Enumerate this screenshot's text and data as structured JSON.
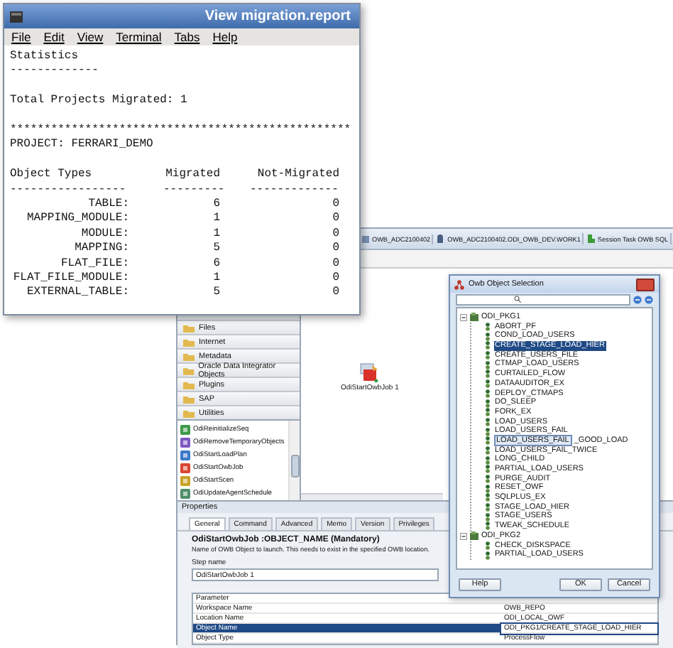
{
  "terminal": {
    "title": "View migration.report",
    "menu": [
      "File",
      "Edit",
      "View",
      "Terminal",
      "Tabs",
      "Help"
    ],
    "paragraphs": [
      [
        "Statistics",
        "-------------"
      ],
      [
        "Total Projects Migrated: 1"
      ],
      [
        "**************************************************",
        "PROJECT: FERRARI_DEMO"
      ]
    ],
    "table": {
      "columns": [
        "Object Types",
        "Migrated",
        "Not-Migrated"
      ],
      "rules": [
        "-----------------",
        "---------",
        "-------------"
      ],
      "rows": [
        {
          "type": "TABLE:",
          "migrated": "6",
          "not_migrated": "0"
        },
        {
          "type": "MAPPING_MODULE:",
          "migrated": "1",
          "not_migrated": "0"
        },
        {
          "type": "MODULE:",
          "migrated": "1",
          "not_migrated": "0"
        },
        {
          "type": "MAPPING:",
          "migrated": "5",
          "not_migrated": "0"
        },
        {
          "type": "FLAT_FILE:",
          "migrated": "6",
          "not_migrated": "0"
        },
        {
          "type": "FLAT_FILE_MODULE:",
          "migrated": "1",
          "not_migrated": "0"
        },
        {
          "type": "EXTERNAL_TABLE:",
          "migrated": "5",
          "not_migrated": "0"
        }
      ]
    }
  },
  "odi": {
    "tabs": [
      {
        "label": "OWB_ADC2100402",
        "selected": false
      },
      {
        "label": "OWB_ADC2100402.ODI_OWB_DEV.WORK1",
        "selected": false
      },
      {
        "label": "Session Task OWB SQL",
        "selected": false
      }
    ],
    "folders": [
      "Files",
      "Internet",
      "Metadata",
      "Oracle Data Integrator Objects",
      "Plugins",
      "SAP",
      "Utilities"
    ],
    "tools": [
      {
        "label": "OdiReinitializeSeq",
        "selected": false
      },
      {
        "label": "OdiRemoveTemporaryObjects",
        "selected": false
      },
      {
        "label": "OdiStartLoadPlan",
        "selected": false
      },
      {
        "label": "OdiStartOwbJob",
        "selected": false
      },
      {
        "label": "OdiStartScen",
        "selected": false
      },
      {
        "label": "OdiUpdateAgentSchedule",
        "selected": false
      }
    ],
    "canvas": {
      "step": "OdiStartOwbJob 1"
    },
    "properties": {
      "title": "Properties",
      "tabs": [
        {
          "label": "General",
          "selected": true
        },
        {
          "label": "Command",
          "selected": false
        },
        {
          "label": "Advanced",
          "selected": false
        },
        {
          "label": "Memo",
          "selected": false
        },
        {
          "label": "Version",
          "selected": false
        },
        {
          "label": "Privileges",
          "selected": false
        }
      ],
      "heading": "OdiStartOwbJob :OBJECT_NAME (Mandatory)",
      "description": "Name of OWB Object to launch. This needs to exist in the specified OWB location.",
      "step_name_label": "Step name",
      "step_name": "OdiStartOwbJob 1",
      "parameters": {
        "column": "Parameter",
        "rows": [
          {
            "name": "Workspace Name",
            "value": "OWB_REPO",
            "selected": false
          },
          {
            "name": "Location Name",
            "value": "ODI_LOCAL_OWF",
            "selected": false
          },
          {
            "name": "Object Name",
            "value": "ODI_PKG1/CREATE_STAGE_LOAD_HIER",
            "selected": true
          },
          {
            "name": "Object Type",
            "value": "ProcessFlow",
            "selected": false
          }
        ]
      }
    }
  },
  "dialog": {
    "title": "Owb Object Selection",
    "tree": [
      {
        "label": "ODI_PKG1",
        "expanded": true,
        "children": [
          {
            "label": "ABORT_PF",
            "selected": false
          },
          {
            "label": "COND_LOAD_USERS",
            "selected": false
          },
          {
            "label": "CREATE_STAGE_LOAD_HIER",
            "selected": true
          },
          {
            "label": "CREATE_USERS_FILE",
            "selected": false
          },
          {
            "label": "CTMAP_LOAD_USERS",
            "selected": false
          },
          {
            "label": "CURTAILED_FLOW",
            "selected": false
          },
          {
            "label": "DATAAUDITOR_EX",
            "selected": false
          },
          {
            "label": "DEPLOY_CTMAPS",
            "selected": false
          },
          {
            "label": "DO_SLEEP",
            "selected": false
          },
          {
            "label": "FORK_EX",
            "selected": false
          },
          {
            "label": "LOAD_USERS",
            "selected": false
          },
          {
            "label": "LOAD_USERS_FAIL",
            "selected": false
          },
          {
            "label": "_GOOD_LOAD",
            "tooltip": "LOAD_USERS_FAIL",
            "selected": false
          },
          {
            "label": "LOAD_USERS_FAIL_TWICE",
            "selected": false
          },
          {
            "label": "LONG_CHILD",
            "selected": false
          },
          {
            "label": "PARTIAL_LOAD_USERS",
            "selected": false
          },
          {
            "label": "PURGE_AUDIT",
            "selected": false
          },
          {
            "label": "RESET_OWF",
            "selected": false
          },
          {
            "label": "SQLPLUS_EX",
            "selected": false
          },
          {
            "label": "STAGE_LOAD_HIER",
            "selected": false
          },
          {
            "label": "STAGE_USERS",
            "selected": false
          },
          {
            "label": "TWEAK_SCHEDULE",
            "selected": false
          }
        ]
      },
      {
        "label": "ODI_PKG2",
        "expanded": true,
        "children": [
          {
            "label": "CHECK_DISKSPACE",
            "selected": false
          },
          {
            "label": "PARTIAL_LOAD_USERS",
            "selected": false
          }
        ]
      }
    ],
    "buttons": [
      "Help",
      "OK",
      "Cancel"
    ]
  }
}
